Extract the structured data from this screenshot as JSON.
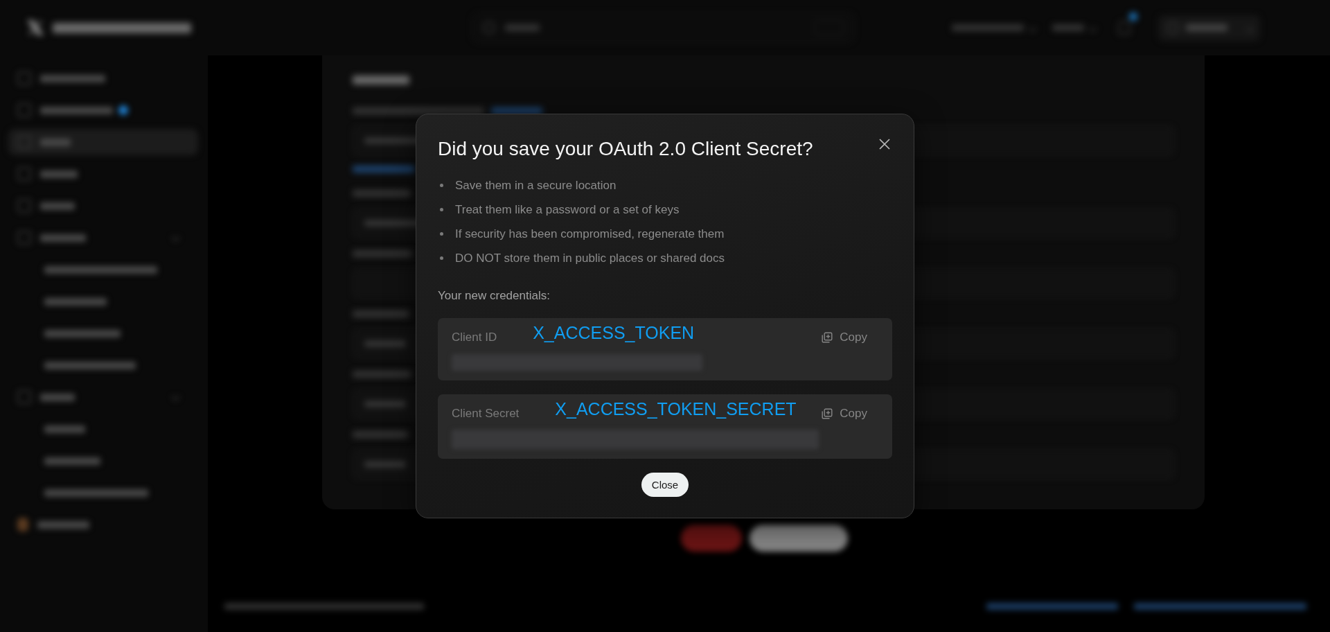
{
  "dialog": {
    "title": "Did you save your OAuth 2.0 Client Secret?",
    "tips": [
      "Save them in a secure location",
      "Treat them like a password or a set of keys",
      "If security has been compromised, regenerate them",
      "DO NOT store them in public places or shared docs"
    ],
    "credentials_heading": "Your new credentials:",
    "credentials": [
      {
        "label": "Client ID",
        "annotation": "X_ACCESS_TOKEN",
        "copy_label": "Copy"
      },
      {
        "label": "Client Secret",
        "annotation": "X_ACCESS_TOKEN_SECRET",
        "copy_label": "Copy"
      }
    ],
    "close_button": "Close"
  }
}
